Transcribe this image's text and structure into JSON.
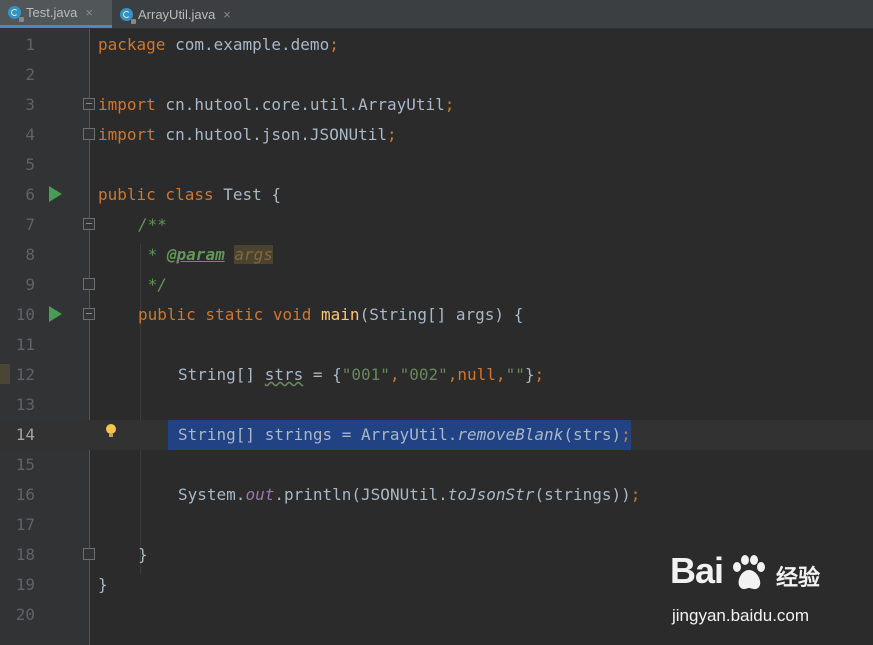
{
  "tabs": [
    {
      "label": "Test.java",
      "active": true
    },
    {
      "label": "ArrayUtil.java",
      "active": false
    }
  ],
  "tab_close_glyph": "×",
  "colors": {
    "background": "#2b2b2b",
    "keyword": "#cc7832",
    "method": "#ffc66d",
    "string": "#6a8759",
    "doc_comment": "#629755",
    "static_field": "#9876aa",
    "selection": "#214283",
    "run_icon": "#499c54"
  },
  "caret_line": 14,
  "line_numbers": [
    "1",
    "2",
    "3",
    "4",
    "5",
    "6",
    "7",
    "8",
    "9",
    "10",
    "11",
    "12",
    "13",
    "14",
    "15",
    "16",
    "17",
    "18",
    "19",
    "20"
  ],
  "code": {
    "l1": {
      "kw": "package",
      "rest": " com.example.demo",
      "semi": ";"
    },
    "l3": {
      "kw": "import",
      "rest": " cn.hutool.core.util.ArrayUtil",
      "semi": ";"
    },
    "l4": {
      "kw": "import",
      "rest": " cn.hutool.json.JSONUtil",
      "semi": ";"
    },
    "l6": {
      "kw": "public class",
      "rest": " Test {"
    },
    "l7": {
      "doc": "/**"
    },
    "l8": {
      "star": " * ",
      "tag": "@param",
      "space": " ",
      "param": "args"
    },
    "l9": {
      "doc": " */"
    },
    "l10": {
      "kw": "public static void",
      "sp": " ",
      "name": "main",
      "rest": "(String[] args) {"
    },
    "l12": {
      "type": "String[] ",
      "var": "strs",
      "eq": " = {",
      "s1": "\"001\"",
      "c1": ",",
      "s2": "\"002\"",
      "c2": ",",
      "nul": "null",
      "c3": ",",
      "s3": "\"\"",
      "end": "}",
      "semi": ";"
    },
    "l14": {
      "pre": "String[] strings = ArrayUtil.",
      "call": "removeBlank",
      "args": "(strs)",
      "semi": ";"
    },
    "l16": {
      "pre": "System.",
      "field": "out",
      "mid": ".println(JSONUtil.",
      "call": "toJsonStr",
      "args": "(strings))",
      "semi": ";"
    },
    "l18": {
      "brace": "}"
    },
    "l19": {
      "brace": "}"
    }
  },
  "watermark": {
    "logo": "Bai",
    "brand": "经验",
    "url": "jingyan.baidu.com"
  },
  "icons": [
    "java-class-icon",
    "close-icon",
    "run-gutter-icon",
    "fold-icon",
    "intention-bulb-icon",
    "baidu-paw-icon"
  ]
}
